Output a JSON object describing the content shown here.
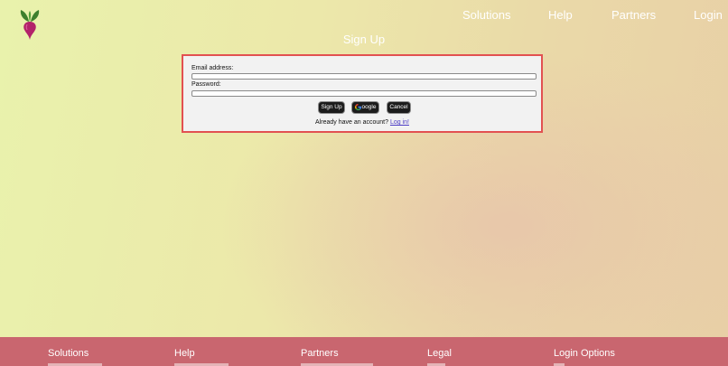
{
  "header": {
    "logo_icon": "beet-icon",
    "nav": [
      "Solutions",
      "Help",
      "Partners",
      "Login"
    ]
  },
  "page": {
    "title": "Sign Up"
  },
  "form": {
    "email_label": "Email address:",
    "email_value": "",
    "password_label": "Password:",
    "password_value": "",
    "signup_button": "Sign Up",
    "google_button": "oogle",
    "google_icon": "google-g-icon",
    "cancel_button": "Cancel",
    "login_prompt": "Already have an account?",
    "login_link": "Log in!"
  },
  "footer": {
    "headings": [
      "Solutions",
      "Help",
      "Partners",
      "Legal",
      "Login Options"
    ]
  },
  "colors": {
    "accent_border": "#e25151",
    "footer_bg": "#c9666f",
    "button_bg": "#1c1c1c",
    "link": "#4b3bc4"
  }
}
